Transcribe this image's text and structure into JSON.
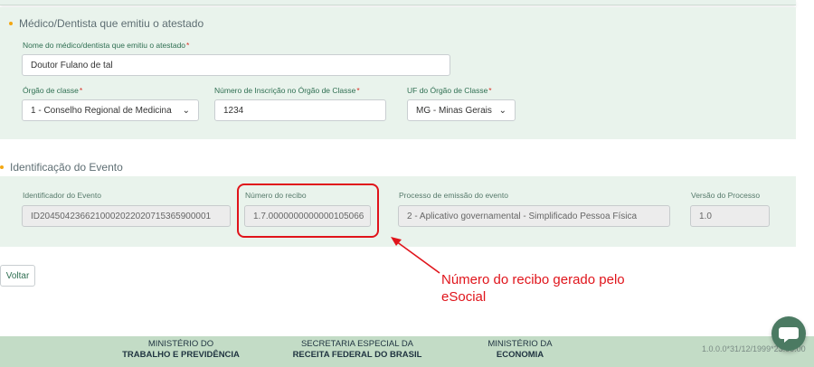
{
  "section1": {
    "title": "Médico/Dentista que emitiu o atestado",
    "doctor_name": {
      "label": "Nome do médico/dentista que emitiu o atestado",
      "value": "Doutor Fulano de tal"
    },
    "orgao_classe": {
      "label": "Órgão de classe",
      "value": "1 - Conselho Regional de Medicina"
    },
    "numero_inscricao": {
      "label": "Número de Inscrição no Órgão de Classe",
      "value": "1234"
    },
    "uf": {
      "label": "UF do Órgão de Classe",
      "value": "MG - Minas Gerais"
    }
  },
  "section2": {
    "title": "Identificação do Evento",
    "identificador": {
      "label": "Identificador do Evento",
      "value": "ID2045042366210002022020715365900001"
    },
    "recibo": {
      "label": "Número do recibo",
      "value": "1.7.0000000000000105066"
    },
    "processo": {
      "label": "Processo de emissão do evento",
      "value": "2 - Aplicativo governamental - Simplificado Pessoa Física"
    },
    "versao": {
      "label": "Versão do Processo",
      "value": "1.0"
    }
  },
  "required_mark": "*",
  "voltar_label": "Voltar",
  "annotation": {
    "line1": "Número do recibo gerado pelo",
    "line2": "eSocial"
  },
  "footer": {
    "org1": {
      "line1": "MINISTÉRIO DO",
      "line2": "TRABALHO E PREVIDÊNCIA"
    },
    "org2": {
      "line1": "SECRETARIA ESPECIAL DA",
      "line2": "RECEITA FEDERAL DO BRASIL"
    },
    "org3": {
      "line1": "MINISTÉRIO DA",
      "line2": "ECONOMIA"
    },
    "version": "1.0.0.0*31/12/1999*23:00:00"
  },
  "colors": {
    "accent_red": "#e0141b",
    "panel_green": "#e9f3ec",
    "footer_green": "#c3dcc6",
    "bullet_orange": "#f3a712"
  },
  "icons": {
    "select_chevron": "chevron-down-icon",
    "chat": "chat-bubble-icon",
    "arrow": "arrow-icon"
  }
}
